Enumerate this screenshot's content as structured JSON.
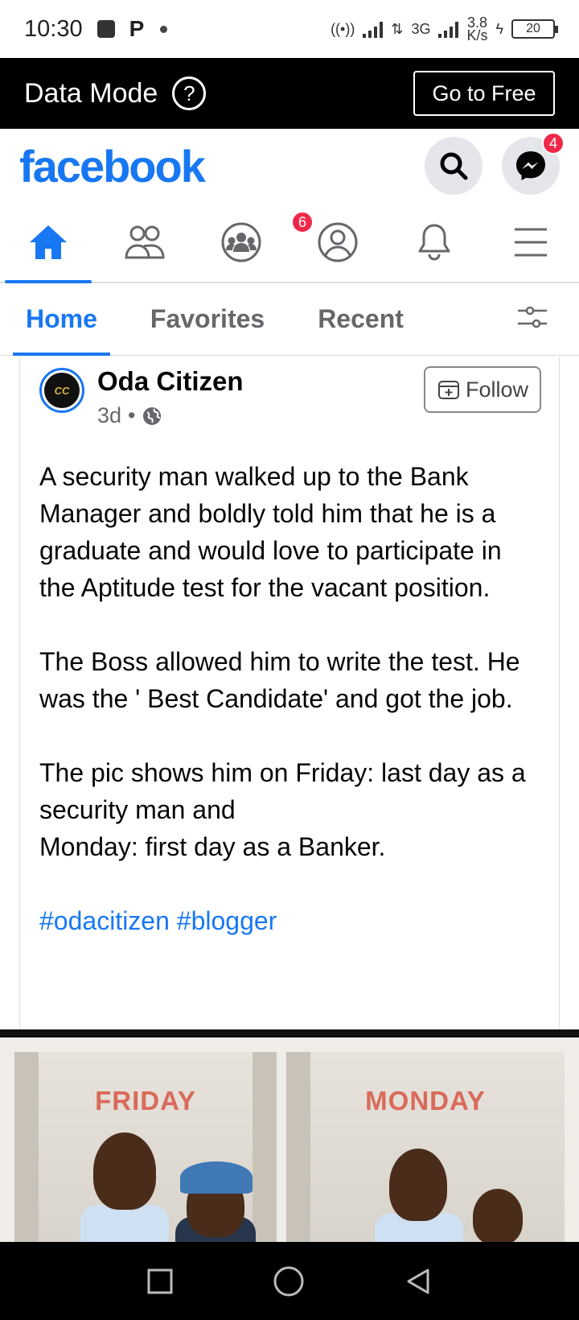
{
  "status_bar": {
    "time": "10:30",
    "network_type": "3G",
    "speed_value": "3.8",
    "speed_unit": "K/s",
    "battery": "20"
  },
  "data_mode": {
    "label": "Data Mode",
    "help_icon": "?",
    "go_free_label": "Go to Free"
  },
  "header": {
    "logo": "facebook",
    "messenger_badge": "4"
  },
  "nav": {
    "groups_badge": "6",
    "active": "home"
  },
  "feed_tabs": [
    {
      "label": "Home",
      "active": true
    },
    {
      "label": "Favorites",
      "active": false
    },
    {
      "label": "Recent",
      "active": false
    }
  ],
  "post": {
    "author": "Oda Citizen",
    "time": "3d",
    "separator": "•",
    "follow_label": "Follow",
    "paragraphs": [
      "A security man walked up to the Bank Manager and boldly told him that he is a graduate and would love to participate in the Aptitude test for the vacant position.",
      "The Boss allowed him to write the test. He was the ' Best Candidate' and got the job.",
      "The pic shows him on Friday: last day as a security man and\nMonday: first day as a Banker."
    ],
    "hashtags": "#odacitizen #blogger",
    "photo_left_caption": "FRIDAY",
    "photo_right_caption": "MONDAY"
  },
  "colors": {
    "brand": "#1877f2",
    "badge": "#f02849",
    "text_secondary": "#65676b"
  }
}
